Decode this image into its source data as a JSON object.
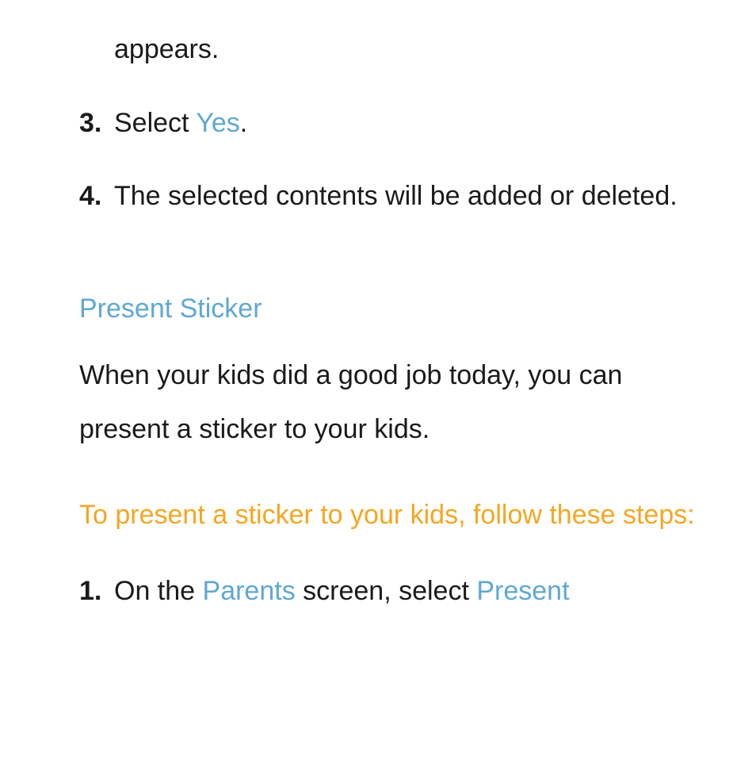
{
  "fragment_top": "appears.",
  "steps_a": [
    {
      "num": "3.",
      "prefix": "Select ",
      "keyword": "Yes",
      "suffix": "."
    },
    {
      "num": "4.",
      "text": "The selected contents will be added or deleted."
    }
  ],
  "section": {
    "heading": "Present Sticker",
    "body": "When your kids did a good job today, you can present a sticker to your kids.",
    "lead": "To present a sticker to your kids, follow these steps:"
  },
  "steps_b": [
    {
      "num": "1.",
      "prefix": "On the ",
      "keyword1": "Parents",
      "mid": " screen, select ",
      "keyword2": "Present"
    }
  ]
}
